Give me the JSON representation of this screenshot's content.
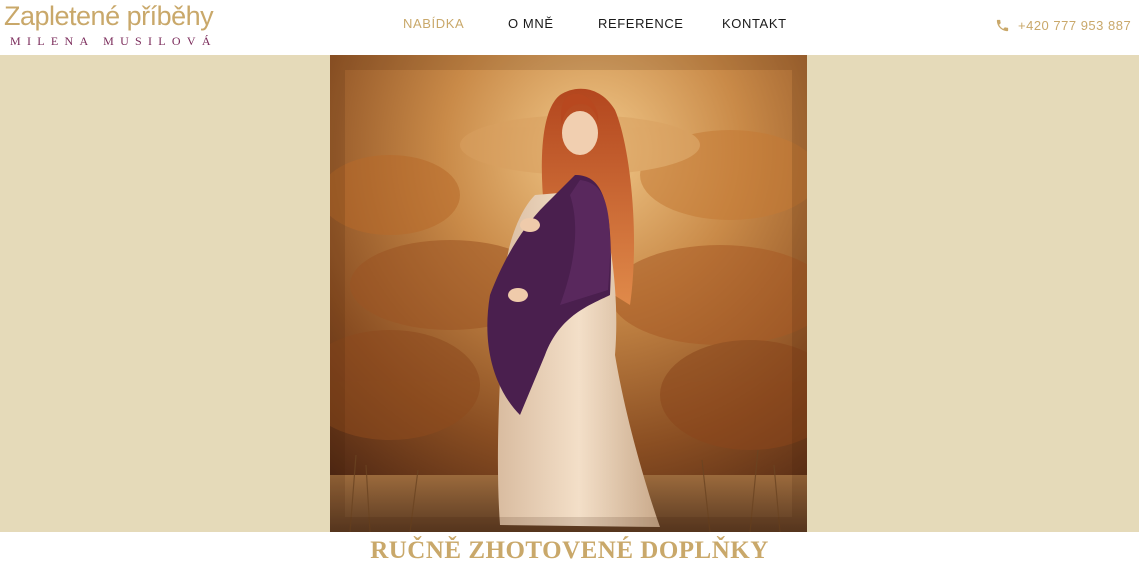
{
  "header": {
    "logo": {
      "title": "Zapletené příběhy",
      "subtitle": "MILENA MUSILOVÁ"
    },
    "nav": [
      {
        "label": "NABÍDKA",
        "active": true
      },
      {
        "label": "O MNĚ",
        "active": false
      },
      {
        "label": "REFERENCE",
        "active": false
      },
      {
        "label": "KONTAKT",
        "active": false
      }
    ],
    "phone": {
      "icon": "phone-icon",
      "number": "+420 777 953 887"
    }
  },
  "hero": {
    "image": "pregnant-woman-autumn-forest-photo"
  },
  "section": {
    "title": "RUČNĚ ZHOTOVENÉ DOPLŇKY"
  },
  "colors": {
    "accent_gold": "#c9a86a",
    "logo_subtitle": "#7a2a5a",
    "hero_background": "#e5dab9",
    "nav_text": "#1a1a1a"
  }
}
